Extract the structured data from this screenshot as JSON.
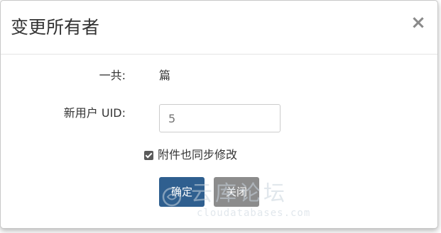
{
  "dialog": {
    "title": "变更所有者",
    "close_glyph": "×"
  },
  "form": {
    "total_label": "一共:",
    "total_value": "篇",
    "uid_label": "新用户 UID:",
    "uid_placeholder": "5",
    "uid_value": "",
    "attachments_checkbox": {
      "label": "附件也同步修改",
      "checked": true
    }
  },
  "buttons": {
    "confirm_label": "确定",
    "close_label": "关闭"
  },
  "watermark": {
    "title": "云库论坛",
    "subtitle": "cloudatabases.com"
  },
  "colors": {
    "confirm_bg": "#2f5f8f",
    "close_bg": "#8c8c8c",
    "checkbox": "#5a5a5a"
  }
}
